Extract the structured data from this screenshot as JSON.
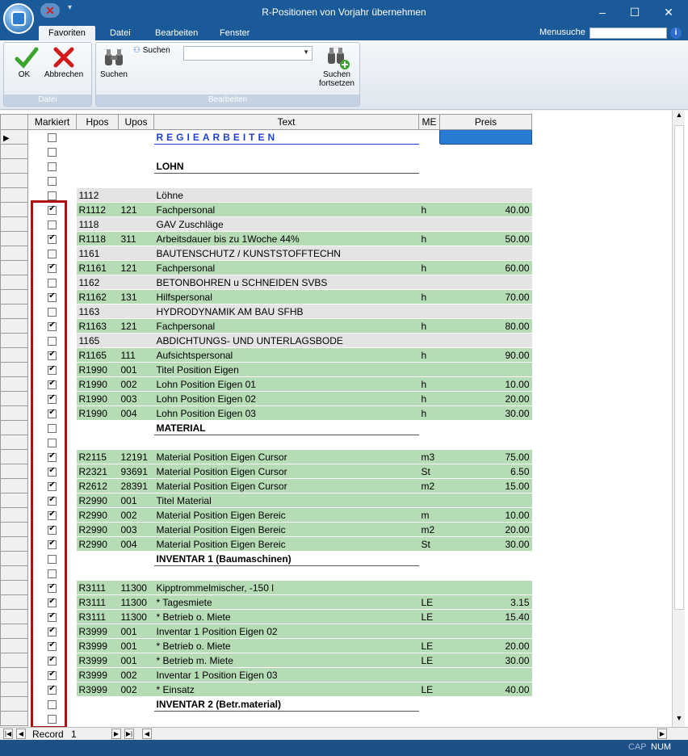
{
  "window": {
    "title": "R-Positionen von Vorjahr übernehmen",
    "minimize": "–",
    "maximize": "☐",
    "close": "✕"
  },
  "menu": {
    "tabs": [
      "Favoriten",
      "Datei",
      "Bearbeiten",
      "Fenster"
    ],
    "active_tab": "Favoriten",
    "menusuche_label": "Menusuche",
    "menusuche_value": ""
  },
  "ribbon": {
    "ok_label": "OK",
    "abbrechen_label": "Abbrechen",
    "group_datei": "Datei",
    "suchen_label": "Suchen",
    "suchen_small_label": "Suchen",
    "suchen_fortsetzen_line1": "Suchen",
    "suchen_fortsetzen_line2": "fortsetzen",
    "group_bearbeiten": "Bearbeiten",
    "combo_value": ""
  },
  "grid": {
    "headers": [
      "Markiert",
      "Hpos",
      "Upos",
      "Text",
      "ME",
      "Preis"
    ],
    "rows": [
      {
        "cb": false,
        "hpos": "",
        "upos": "",
        "text": "REGIEARBEITEN",
        "me": "",
        "preis": "",
        "style": "big"
      },
      {
        "cb": false,
        "hpos": "",
        "upos": "",
        "text": "",
        "me": "",
        "preis": "",
        "style": "blank"
      },
      {
        "cb": false,
        "hpos": "",
        "upos": "",
        "text": "LOHN",
        "me": "",
        "preis": "",
        "style": "sec"
      },
      {
        "cb": false,
        "hpos": "",
        "upos": "",
        "text": "",
        "me": "",
        "preis": "",
        "style": "blank"
      },
      {
        "cb": false,
        "hpos": "1112",
        "upos": "",
        "text": "Löhne",
        "me": "",
        "preis": "",
        "style": "gray"
      },
      {
        "cb": true,
        "hpos": "R1112",
        "upos": "121",
        "text": "Fachpersonal",
        "me": "h",
        "preis": "40.00",
        "style": "green"
      },
      {
        "cb": false,
        "hpos": "1118",
        "upos": "",
        "text": "GAV Zuschläge",
        "me": "",
        "preis": "",
        "style": "gray"
      },
      {
        "cb": true,
        "hpos": "R1118",
        "upos": "311",
        "text": "Arbeitsdauer bis zu 1Woche 44%",
        "me": "h",
        "preis": "50.00",
        "style": "green"
      },
      {
        "cb": false,
        "hpos": "1161",
        "upos": "",
        "text": "BAUTENSCHUTZ / KUNSTSTOFFTECHN",
        "me": "",
        "preis": "",
        "style": "gray"
      },
      {
        "cb": true,
        "hpos": "R1161",
        "upos": "121",
        "text": "Fachpersonal",
        "me": "h",
        "preis": "60.00",
        "style": "green"
      },
      {
        "cb": false,
        "hpos": "1162",
        "upos": "",
        "text": "BETONBOHREN u SCHNEIDEN SVBS",
        "me": "",
        "preis": "",
        "style": "gray"
      },
      {
        "cb": true,
        "hpos": "R1162",
        "upos": "131",
        "text": "Hilfspersonal",
        "me": "h",
        "preis": "70.00",
        "style": "green"
      },
      {
        "cb": false,
        "hpos": "1163",
        "upos": "",
        "text": "HYDRODYNAMIK AM BAU SFHB",
        "me": "",
        "preis": "",
        "style": "gray"
      },
      {
        "cb": true,
        "hpos": "R1163",
        "upos": "121",
        "text": "Fachpersonal",
        "me": "h",
        "preis": "80.00",
        "style": "green"
      },
      {
        "cb": false,
        "hpos": "1165",
        "upos": "",
        "text": "ABDICHTUNGS- UND UNTERLAGSBODE",
        "me": "",
        "preis": "",
        "style": "gray"
      },
      {
        "cb": true,
        "hpos": "R1165",
        "upos": "111",
        "text": "Aufsichtspersonal",
        "me": "h",
        "preis": "90.00",
        "style": "green"
      },
      {
        "cb": true,
        "hpos": "R1990",
        "upos": "001",
        "text": "Titel Position Eigen",
        "me": "",
        "preis": "",
        "style": "green"
      },
      {
        "cb": true,
        "hpos": "R1990",
        "upos": "002",
        "text": "Lohn Position Eigen 01",
        "me": "h",
        "preis": "10.00",
        "style": "green"
      },
      {
        "cb": true,
        "hpos": "R1990",
        "upos": "003",
        "text": "Lohn Position Eigen 02",
        "me": "h",
        "preis": "20.00",
        "style": "green"
      },
      {
        "cb": true,
        "hpos": "R1990",
        "upos": "004",
        "text": "Lohn Position Eigen 03",
        "me": "h",
        "preis": "30.00",
        "style": "green"
      },
      {
        "cb": false,
        "hpos": "",
        "upos": "",
        "text": "MATERIAL",
        "me": "",
        "preis": "",
        "style": "sec"
      },
      {
        "cb": false,
        "hpos": "",
        "upos": "",
        "text": "",
        "me": "",
        "preis": "",
        "style": "blank"
      },
      {
        "cb": true,
        "hpos": "R2115",
        "upos": "12191",
        "text": "Material Position Eigen Cursor",
        "me": "m3",
        "preis": "75.00",
        "style": "green"
      },
      {
        "cb": true,
        "hpos": "R2321",
        "upos": "93691",
        "text": "Material Position Eigen Cursor",
        "me": "St",
        "preis": "6.50",
        "style": "green"
      },
      {
        "cb": true,
        "hpos": "R2612",
        "upos": "28391",
        "text": "Material Position Eigen Cursor",
        "me": "m2",
        "preis": "15.00",
        "style": "green"
      },
      {
        "cb": true,
        "hpos": "R2990",
        "upos": "001",
        "text": "Titel Material",
        "me": "",
        "preis": "",
        "style": "green"
      },
      {
        "cb": true,
        "hpos": "R2990",
        "upos": "002",
        "text": "Material Position Eigen Bereic",
        "me": "m",
        "preis": "10.00",
        "style": "green"
      },
      {
        "cb": true,
        "hpos": "R2990",
        "upos": "003",
        "text": "Material Position Eigen Bereic",
        "me": "m2",
        "preis": "20.00",
        "style": "green"
      },
      {
        "cb": true,
        "hpos": "R2990",
        "upos": "004",
        "text": "Material Position Eigen Bereic",
        "me": "St",
        "preis": "30.00",
        "style": "green"
      },
      {
        "cb": false,
        "hpos": "",
        "upos": "",
        "text": "INVENTAR 1 (Baumaschinen)",
        "me": "",
        "preis": "",
        "style": "sec"
      },
      {
        "cb": false,
        "hpos": "",
        "upos": "",
        "text": "",
        "me": "",
        "preis": "",
        "style": "blank"
      },
      {
        "cb": true,
        "hpos": "R3111",
        "upos": "11300",
        "text": "Kipptrommelmischer, -150 l",
        "me": "",
        "preis": "",
        "style": "green"
      },
      {
        "cb": true,
        "hpos": "R3111",
        "upos": "11300",
        "text": "* Tagesmiete",
        "me": "LE",
        "preis": "3.15",
        "style": "green"
      },
      {
        "cb": true,
        "hpos": "R3111",
        "upos": "11300",
        "text": "* Betrieb o. Miete",
        "me": "LE",
        "preis": "15.40",
        "style": "green"
      },
      {
        "cb": true,
        "hpos": "R3999",
        "upos": "001",
        "text": "Inventar 1 Position Eigen 02",
        "me": "",
        "preis": "",
        "style": "green"
      },
      {
        "cb": true,
        "hpos": "R3999",
        "upos": "001",
        "text": "* Betrieb o. Miete",
        "me": "LE",
        "preis": "20.00",
        "style": "green"
      },
      {
        "cb": true,
        "hpos": "R3999",
        "upos": "001",
        "text": "* Betrieb m. Miete",
        "me": "LE",
        "preis": "30.00",
        "style": "green"
      },
      {
        "cb": true,
        "hpos": "R3999",
        "upos": "002",
        "text": "Inventar 1 Position Eigen 03",
        "me": "",
        "preis": "",
        "style": "green"
      },
      {
        "cb": true,
        "hpos": "R3999",
        "upos": "002",
        "text": "* Einsatz",
        "me": "LE",
        "preis": "40.00",
        "style": "green"
      },
      {
        "cb": false,
        "hpos": "",
        "upos": "",
        "text": "INVENTAR 2 (Betr.material)",
        "me": "",
        "preis": "",
        "style": "sec"
      },
      {
        "cb": false,
        "hpos": "",
        "upos": "",
        "text": "",
        "me": "",
        "preis": "",
        "style": "blank"
      }
    ]
  },
  "navigation": {
    "record_label": "Record",
    "record_value": "1"
  },
  "status": {
    "cap": "CAP",
    "num": "NUM"
  }
}
